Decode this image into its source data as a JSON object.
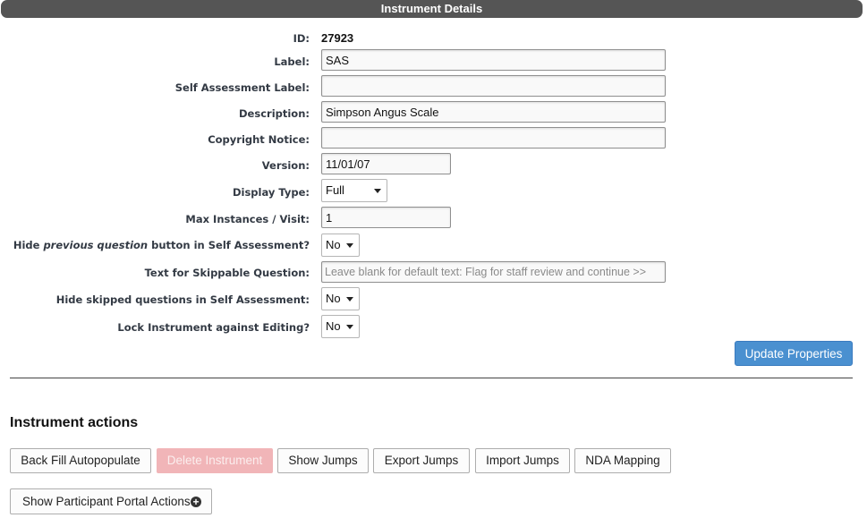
{
  "header": {
    "title": "Instrument Details"
  },
  "form": {
    "id": {
      "label": "ID:",
      "value": "27923"
    },
    "label": {
      "label": "Label:",
      "value": "SAS"
    },
    "self_assessment_label": {
      "label": "Self Assessment Label:",
      "value": ""
    },
    "description": {
      "label": "Description:",
      "value": "Simpson Angus Scale"
    },
    "copyright_notice": {
      "label": "Copyright Notice:",
      "value": ""
    },
    "version": {
      "label": "Version:",
      "value": "11/01/07"
    },
    "display_type": {
      "label": "Display Type:",
      "value": "Full"
    },
    "max_instances": {
      "label": "Max Instances / Visit:",
      "value": "1"
    },
    "hide_previous": {
      "label_pre": "Hide ",
      "label_em": "previous question",
      "label_post": " button in Self Assessment?",
      "value": "No"
    },
    "skippable_text": {
      "label": "Text for Skippable Question:",
      "value": "",
      "placeholder": "Leave blank for default text: Flag for staff review and continue >>"
    },
    "hide_skipped": {
      "label": "Hide skipped questions in Self Assessment:",
      "value": "No"
    },
    "lock_instrument": {
      "label": "Lock Instrument against Editing?",
      "value": "No"
    },
    "update_button": "Update Properties"
  },
  "actions": {
    "title": "Instrument actions",
    "back_fill": "Back Fill Autopopulate",
    "delete": "Delete Instrument",
    "show_jumps": "Show Jumps",
    "export_jumps": "Export Jumps",
    "import_jumps": "Import Jumps",
    "nda_mapping": "NDA Mapping",
    "portal_actions": "Show Participant Portal Actions"
  },
  "icons": {
    "plus": "plus-circle-icon",
    "dropdown": "chevron-down-icon"
  },
  "colors": {
    "header_bg": "#555555",
    "primary": "#4a90d0",
    "danger_disabled": "#f1b5b8"
  }
}
